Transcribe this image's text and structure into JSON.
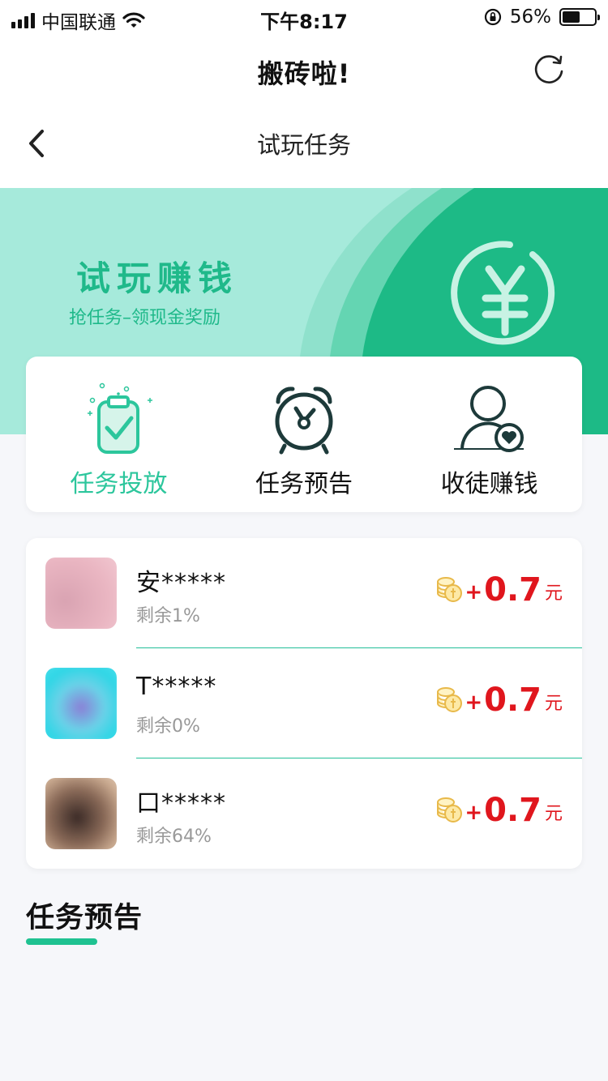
{
  "status_bar": {
    "carrier": "中国联通",
    "time": "下午8:17",
    "battery_percent": "56%",
    "battery_level": 0.56
  },
  "header": {
    "app_title": "搬砖啦!",
    "page_title": "试玩任务"
  },
  "banner": {
    "title": "试玩赚钱",
    "subtitle": "抢任务–领现金奖励"
  },
  "actions": [
    {
      "label": "任务投放",
      "icon": "clipboard-check-icon",
      "active": true
    },
    {
      "label": "任务预告",
      "icon": "alarm-clock-icon",
      "active": false
    },
    {
      "label": "收徒赚钱",
      "icon": "user-heart-icon",
      "active": false
    }
  ],
  "tasks": [
    {
      "name": "安*****",
      "remain": "剩余1%",
      "plus": "+",
      "amount": "0.7",
      "unit": "元"
    },
    {
      "name": "T*****",
      "remain": "剩余0%",
      "plus": "+",
      "amount": "0.7",
      "unit": "元"
    },
    {
      "name": "口*****",
      "remain": "剩余64%",
      "plus": "+",
      "amount": "0.7",
      "unit": "元"
    }
  ],
  "section": {
    "title": "任务预告"
  },
  "colors": {
    "accent": "#1fc291",
    "reward": "#e0161d",
    "banner_light": "#a6eadb",
    "banner_dark": "#1dba86"
  }
}
